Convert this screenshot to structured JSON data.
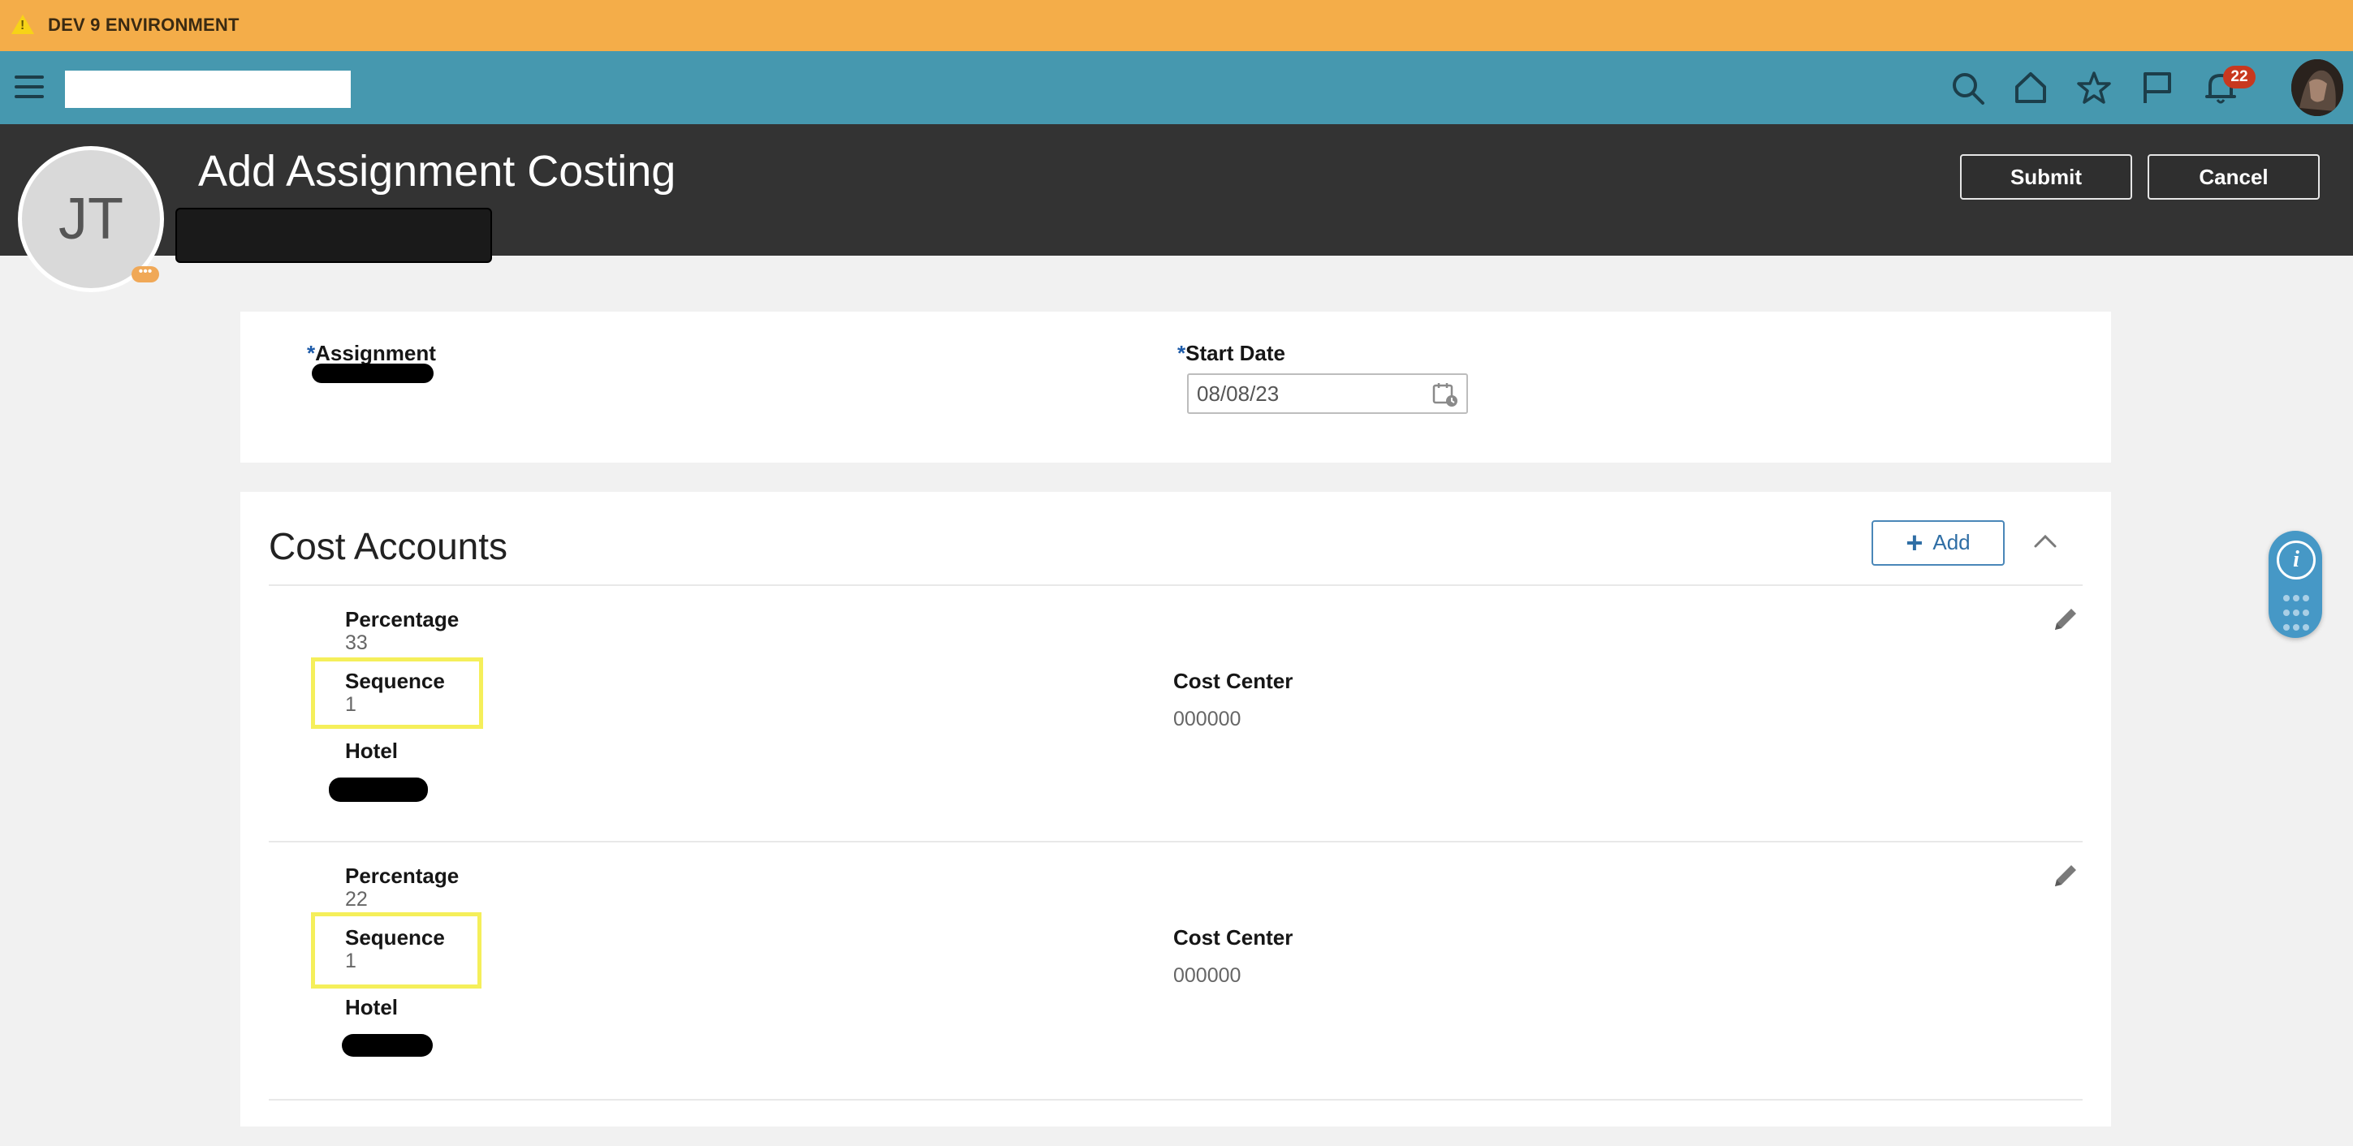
{
  "environment": {
    "label": "DEV 9 ENVIRONMENT"
  },
  "nav": {
    "search_value": "",
    "notifications_count": "22",
    "icons": [
      "search-icon",
      "home-icon",
      "star-icon",
      "flag-icon",
      "bell-icon"
    ]
  },
  "header": {
    "title": "Add Assignment Costing",
    "avatar_initials": "JT",
    "avatar_badge": "•••",
    "submit_label": "Submit",
    "cancel_label": "Cancel"
  },
  "assignment_form": {
    "required_mark": "*",
    "assignment_label": "Assignment",
    "start_date_label": "Start Date",
    "start_date_value": "08/08/23"
  },
  "cost_accounts": {
    "title": "Cost Accounts",
    "add_label": "Add",
    "items": [
      {
        "percentage_label": "Percentage",
        "percentage": "33",
        "sequence_label": "Sequence",
        "sequence": "1",
        "hotel_label": "Hotel",
        "cost_center_label": "Cost Center",
        "cost_center": "000000"
      },
      {
        "percentage_label": "Percentage",
        "percentage": "22",
        "sequence_label": "Sequence",
        "sequence": "1",
        "hotel_label": "Hotel",
        "cost_center_label": "Cost Center",
        "cost_center": "000000"
      }
    ]
  },
  "colors": {
    "env_banner": "#f4ad49",
    "nav_bar": "#4698af",
    "header_band": "#333333",
    "highlight": "#f5ef5a",
    "accent": "#2f6ea5"
  }
}
